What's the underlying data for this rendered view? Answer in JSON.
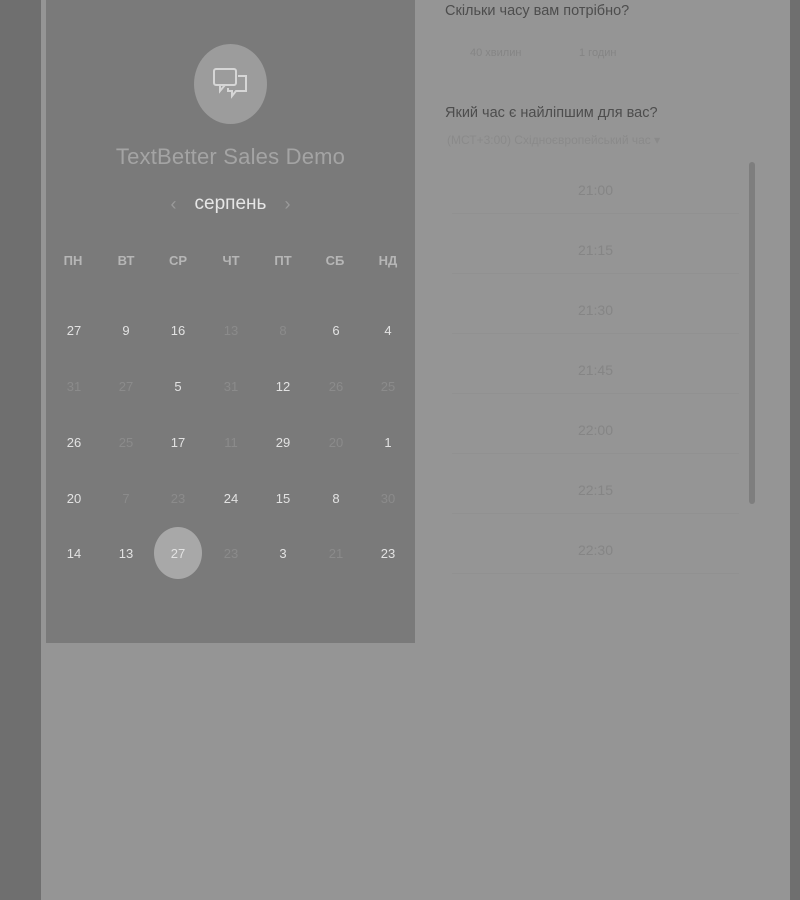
{
  "booking": {
    "title": "TextBetter Sales Demo",
    "month": "серпень"
  },
  "calendar": {
    "weekdays": [
      "ПН",
      "ВТ",
      "СР",
      "ЧТ",
      "ПТ",
      "СБ",
      "НД"
    ],
    "rows": [
      [
        {
          "d": "27",
          "a": true
        },
        {
          "d": "9",
          "a": true
        },
        {
          "d": "16",
          "a": true
        },
        {
          "d": "13",
          "a": false
        },
        {
          "d": "8",
          "a": false
        },
        {
          "d": "6",
          "a": true
        },
        {
          "d": "4",
          "a": true
        }
      ],
      [
        {
          "d": "31",
          "a": false
        },
        {
          "d": "27",
          "a": false
        },
        {
          "d": "5",
          "a": true
        },
        {
          "d": "31",
          "a": false
        },
        {
          "d": "12",
          "a": true
        },
        {
          "d": "26",
          "a": false
        },
        {
          "d": "25",
          "a": false
        }
      ],
      [
        {
          "d": "26",
          "a": true
        },
        {
          "d": "25",
          "a": false
        },
        {
          "d": "17",
          "a": true
        },
        {
          "d": "11",
          "a": false
        },
        {
          "d": "29",
          "a": true
        },
        {
          "d": "20",
          "a": false
        },
        {
          "d": "1",
          "a": true
        }
      ],
      [
        {
          "d": "20",
          "a": true
        },
        {
          "d": "7",
          "a": false
        },
        {
          "d": "23",
          "a": false
        },
        {
          "d": "24",
          "a": true
        },
        {
          "d": "15",
          "a": true
        },
        {
          "d": "8",
          "a": true
        },
        {
          "d": "30",
          "a": false
        }
      ],
      [
        {
          "d": "14",
          "a": true
        },
        {
          "d": "13",
          "a": true
        },
        {
          "d": "27",
          "a": true,
          "selected": true
        },
        {
          "d": "23",
          "a": false
        },
        {
          "d": "3",
          "a": true
        },
        {
          "d": "21",
          "a": false
        },
        {
          "d": "23",
          "a": true
        }
      ]
    ]
  },
  "duration": {
    "question": "Скільки часу вам потрібно?",
    "options": [
      "40 хвилин",
      "1 годин"
    ]
  },
  "time": {
    "question": "Який час є найліпшим для вас?",
    "timezone": "(МСТ+3:00) Східноєвропейський час ▾",
    "slots": [
      "21:00",
      "21:15",
      "21:30",
      "21:45",
      "22:00",
      "22:15",
      "22:30"
    ]
  }
}
